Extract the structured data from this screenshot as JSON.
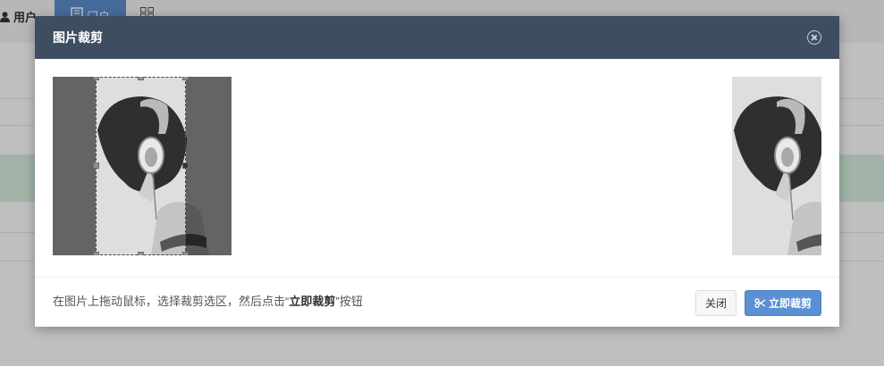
{
  "background": {
    "user_label": "用户",
    "active_tab_label": "门户"
  },
  "modal": {
    "title": "图片裁剪",
    "hint_prefix": "在图片上拖动鼠标，选择裁剪选区，然后点击“",
    "hint_bold": "立即裁剪",
    "hint_suffix": "”按钮",
    "close_button": "关闭",
    "crop_button": "立即裁剪"
  },
  "colors": {
    "header_bg": "#3e4d60",
    "primary": "#5b91d3"
  }
}
